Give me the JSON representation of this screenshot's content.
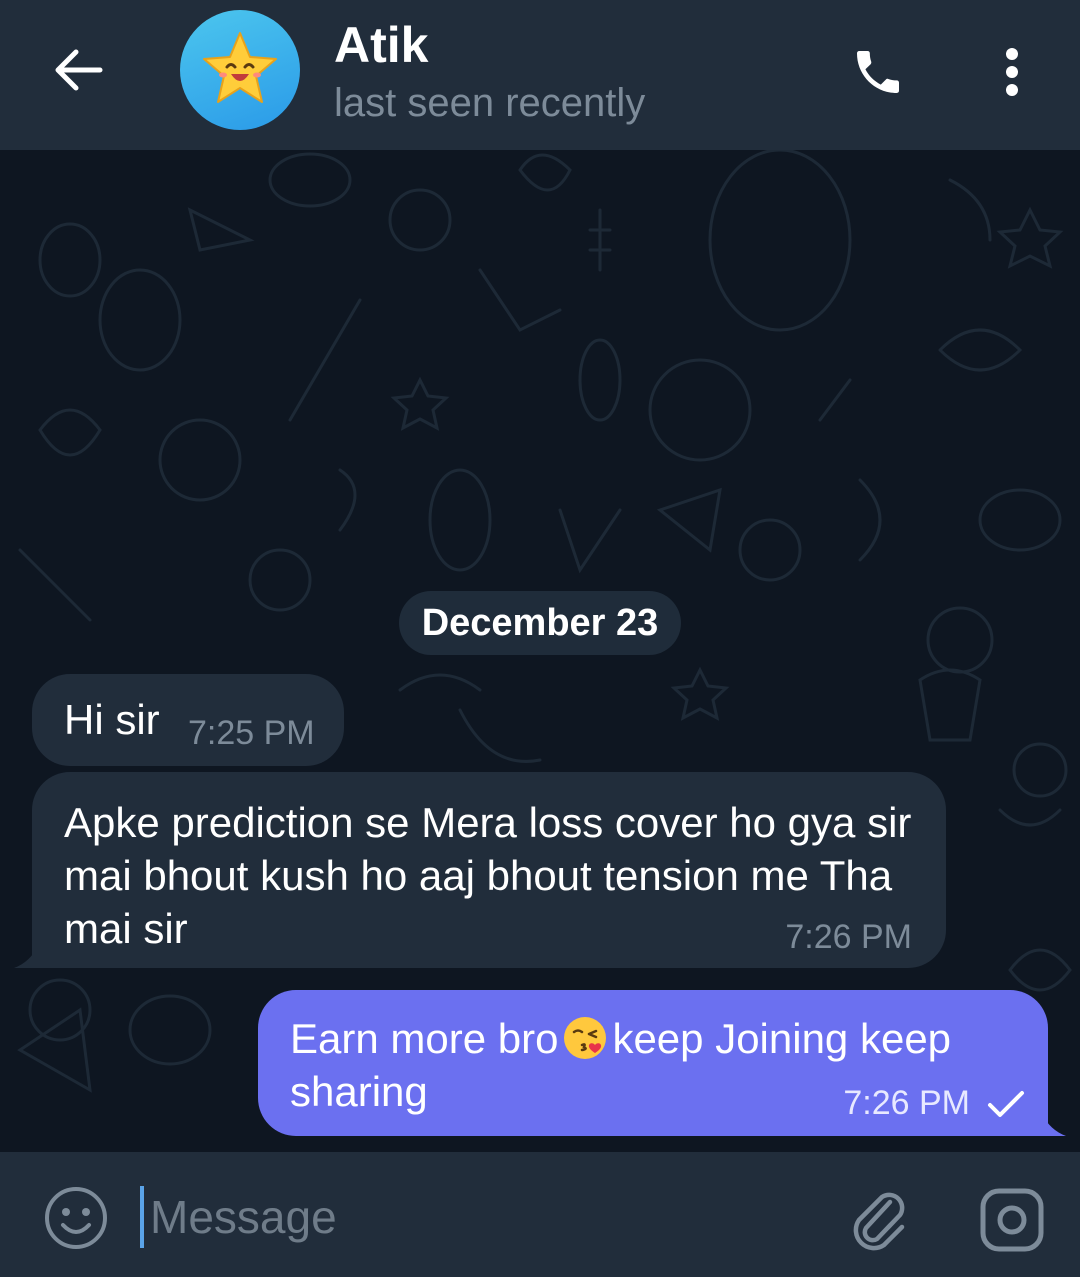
{
  "header": {
    "back_icon": "arrow-left-icon",
    "avatar_icon": "star-emoji-icon",
    "contact_name": "Atik",
    "status": "last seen recently",
    "call_icon": "phone-icon",
    "more_icon": "more-vertical-icon"
  },
  "chat": {
    "date_separator": "December 23",
    "messages": [
      {
        "direction": "incoming",
        "text": "Hi sir",
        "time": "7:25 PM"
      },
      {
        "direction": "incoming",
        "text": "Apke prediction se Mera loss cover ho gya sir mai bhout kush ho aaj bhout tension me Tha mai sir",
        "time": "7:26 PM"
      },
      {
        "direction": "outgoing",
        "text_before_emoji": "Earn more bro",
        "emoji": "kissing-heart-emoji",
        "text_after_emoji": "keep Joining keep sharing",
        "time": "7:26 PM",
        "status_icon": "single-check-icon"
      }
    ]
  },
  "input_bar": {
    "emoji_icon": "smiley-icon",
    "placeholder": "Message",
    "attach_icon": "paperclip-icon",
    "camera_icon": "camera-icon"
  },
  "colors": {
    "header_bg": "#212d3b",
    "chat_bg": "#0e1621",
    "incoming_bubble": "#212d3b",
    "outgoing_bubble": "#6b70f0",
    "secondary_text": "#7d8b99",
    "accent": "#5aa3e8"
  }
}
